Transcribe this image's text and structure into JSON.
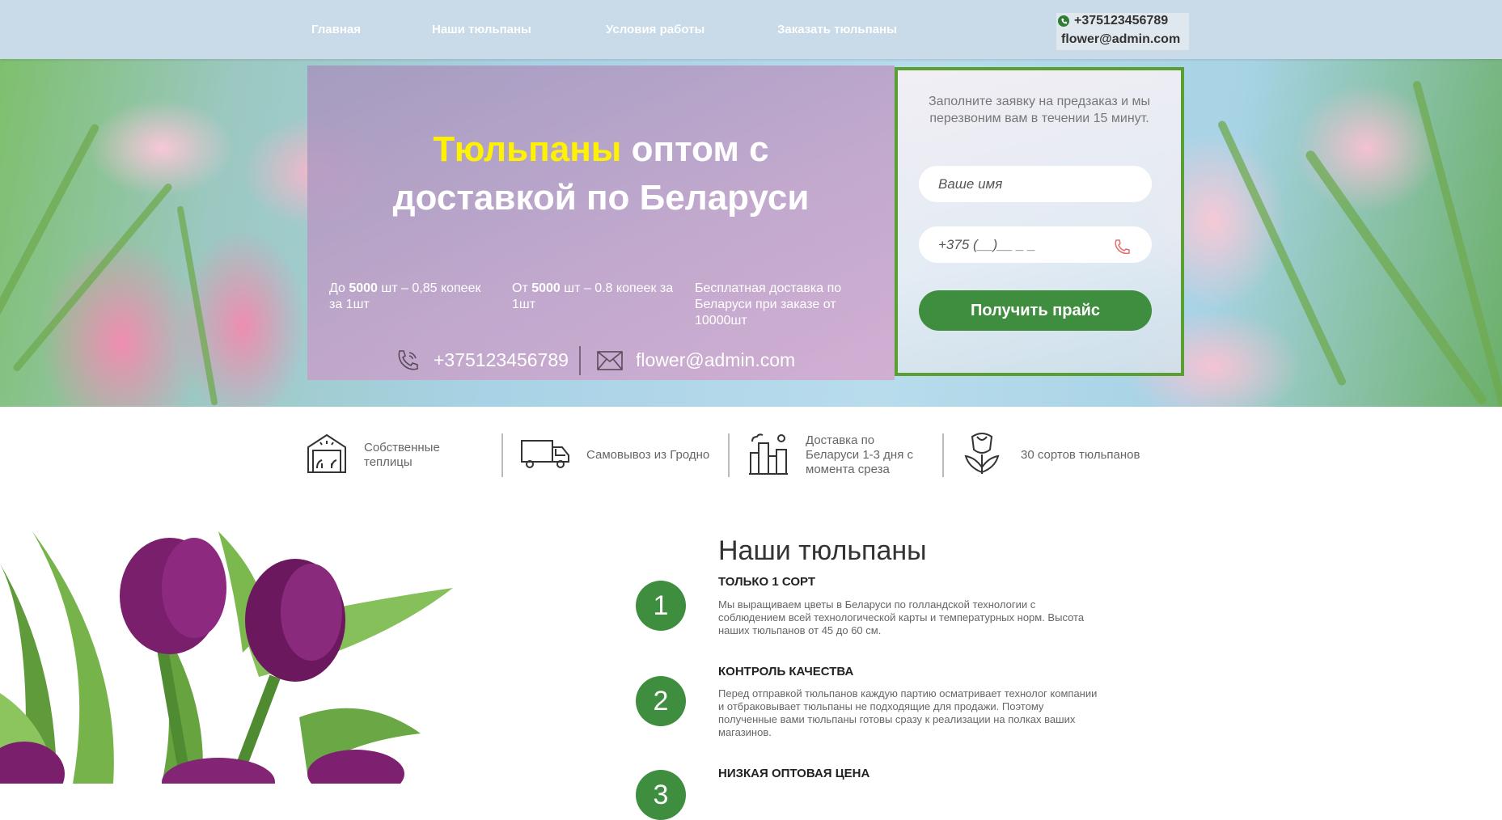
{
  "nav": {
    "items": [
      "Главная",
      "Наши тюльпаны",
      "Условия работы",
      "Заказать тюльпаны"
    ],
    "phone": "+375123456789",
    "email": "flower@admin.com"
  },
  "hero": {
    "title_highlight": "Тюльпаны",
    "title_rest_1": " оптом с",
    "title_rest_2": "доставкой по Беларуси",
    "features": [
      {
        "pre": "До ",
        "bold": "5000",
        "post": " шт – 0,85 копеек за 1шт"
      },
      {
        "pre": "От ",
        "bold": "5000",
        "post": " шт – 0.8 копеек за 1шт"
      },
      {
        "pre": "",
        "bold": "",
        "post": "Бесплатная доставка по Беларуси при заказе от 10000шт"
      }
    ],
    "phone": "+375123456789",
    "email": "flower@admin.com"
  },
  "form": {
    "description": "Заполните заявку на предзаказ и мы перезвоним вам в течении 15 минут.",
    "name_placeholder": "Ваше имя",
    "phone_placeholder": "+375 (__)__ _ _",
    "submit_label": "Получить прайс"
  },
  "advantages": [
    {
      "icon": "greenhouse-icon",
      "label": "Собственные теплицы"
    },
    {
      "icon": "truck-icon",
      "label": "Самовывоз из Гродно"
    },
    {
      "icon": "city-icon",
      "label": "Доставка по Беларуси 1-3 дня с момента среза"
    },
    {
      "icon": "tulip-icon",
      "label": "30 сортов тюльпанов"
    }
  ],
  "section": {
    "title": "Наши тюльпаны",
    "steps": [
      {
        "number": "1",
        "heading": "ТОЛЬКО 1 СОРТ",
        "text": "Мы выращиваем цветы в Беларуси по голландской технологии с соблюдением всей технологической карты и температурных норм. Высота наших тюльпанов от 45 до 60 см."
      },
      {
        "number": "2",
        "heading": "КОНТРОЛЬ КАЧЕСТВА",
        "text": "Перед отправкой тюльпанов каждую партию осматривает технолог компании и отбраковывает тюльпаны не подходящие для продажи. Поэтому полученные вами тюльпаны готовы сразу к реализации на полках ваших магазинов."
      },
      {
        "number": "3",
        "heading": "НИЗКАЯ ОПТОВАЯ ЦЕНА",
        "text": ""
      }
    ]
  },
  "colors": {
    "accent_green": "#3f8e3f",
    "highlight_yellow": "#fff200",
    "nav_bg": "#c9dbe9"
  }
}
